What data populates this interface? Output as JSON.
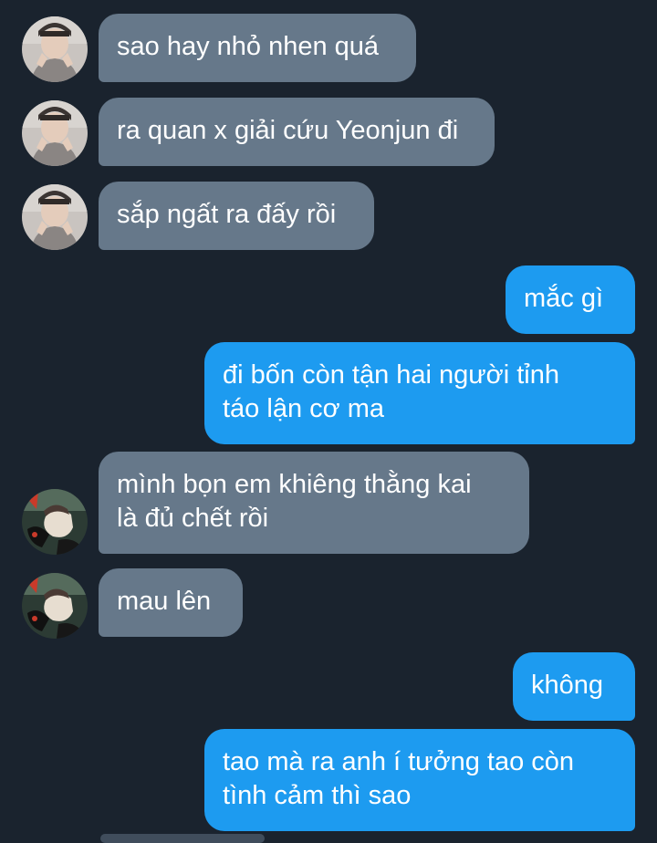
{
  "conversation": {
    "messages": [
      {
        "side": "in",
        "text": "sao hay nhỏ nhen quá",
        "avatar": "user-a-avatar"
      },
      {
        "side": "in",
        "text": "ra quan x giải cứu Yeonjun đi",
        "avatar": "user-a-avatar"
      },
      {
        "side": "in",
        "text": "sắp ngất ra đấy rồi",
        "avatar": "user-a-avatar"
      },
      {
        "side": "out",
        "text": "mắc gì"
      },
      {
        "side": "out",
        "text": "đi bốn còn tận hai người tỉnh\ntáo lận cơ ma"
      },
      {
        "side": "in",
        "text": "mình bọn em khiêng thằng kai\nlà đủ chết rồi",
        "avatar": "user-b-avatar"
      },
      {
        "side": "in",
        "text": "mau lên",
        "avatar": "user-b-avatar"
      },
      {
        "side": "out",
        "text": "không"
      },
      {
        "side": "out",
        "text": "tao mà ra anh í tưởng tao còn\ntình cảm thì sao"
      }
    ]
  },
  "colors": {
    "background": "#1a232e",
    "incoming_bubble": "#66788a",
    "outgoing_bubble": "#1d9bf0",
    "text": "#ffffff"
  }
}
